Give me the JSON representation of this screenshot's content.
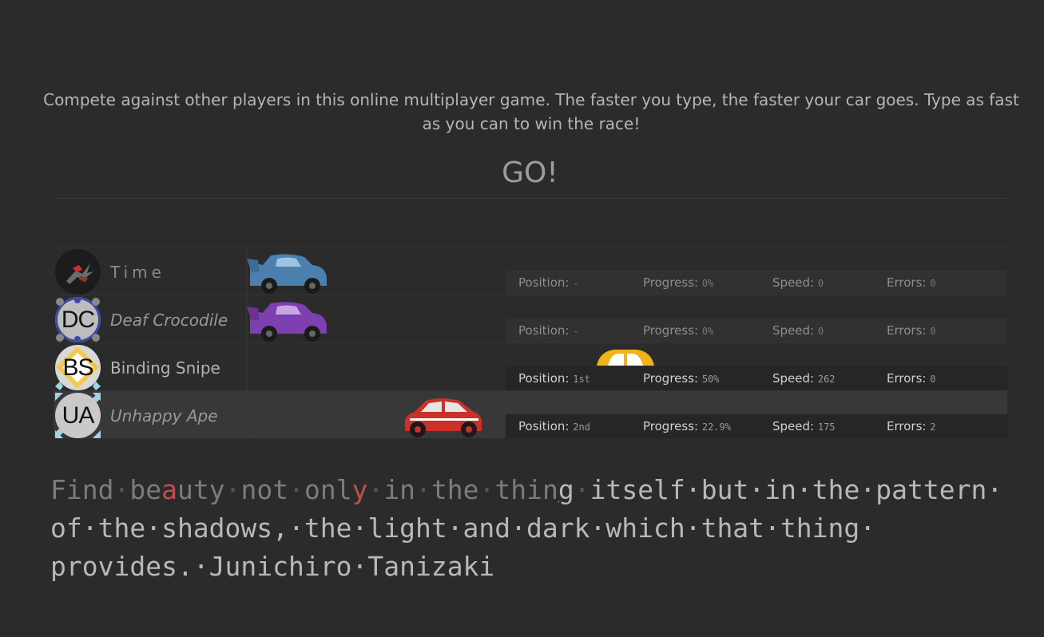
{
  "intro": "Compete against other players in this online multiplayer game. The faster you type, the faster your car goes. Type as fast as you can to win the race!",
  "status": "GO!",
  "labels": {
    "position": "Position:",
    "progress": "Progress:",
    "speed": "Speed:",
    "errors": "Errors:"
  },
  "players": [
    {
      "name": "Time",
      "initials": "",
      "avatar_icon": "dragon-icon",
      "position": "-",
      "progress": "0%",
      "progress_value": 0,
      "speed": "0",
      "errors": "0",
      "car_color": "#4a7fae",
      "car_style": "spoiler"
    },
    {
      "name": "Deaf Crocodile",
      "initials": "DC",
      "avatar_icon": "pattern-avatar",
      "position": "-",
      "progress": "0%",
      "progress_value": 0,
      "speed": "0",
      "errors": "0",
      "car_color": "#7e3fb1",
      "car_style": "spoiler"
    },
    {
      "name": "Binding Snipe",
      "initials": "BS",
      "avatar_icon": "pattern-avatar",
      "position": "1st",
      "progress": "50%",
      "progress_value": 50,
      "speed": "262",
      "errors": "0",
      "car_color": "#f2b319",
      "car_style": "taxi"
    },
    {
      "name": "Unhappy Ape",
      "initials": "UA",
      "avatar_icon": "pattern-avatar",
      "position": "2nd",
      "progress": "22.9%",
      "progress_value": 22.9,
      "speed": "175",
      "errors": "2",
      "car_color": "#c8322a",
      "car_style": "hatch"
    }
  ],
  "typing": {
    "line1_done": "Find",
    "line1_part_be": "be",
    "line1_err_a": "a",
    "line1_part_uty": "uty",
    "line1_not": "not",
    "line1_onl": "onl",
    "line1_err_y": "y",
    "line1_in": "in",
    "line1_the": "the",
    "line1_thin": "thin",
    "line1_g": "g",
    "line1_rest": "itself·but·in·the·pattern·",
    "line2": "of·the·shadows,·the·light·and·dark·which·that·thing·",
    "line3": "provides.·Junichiro·Tanizaki",
    "dot": "·"
  }
}
